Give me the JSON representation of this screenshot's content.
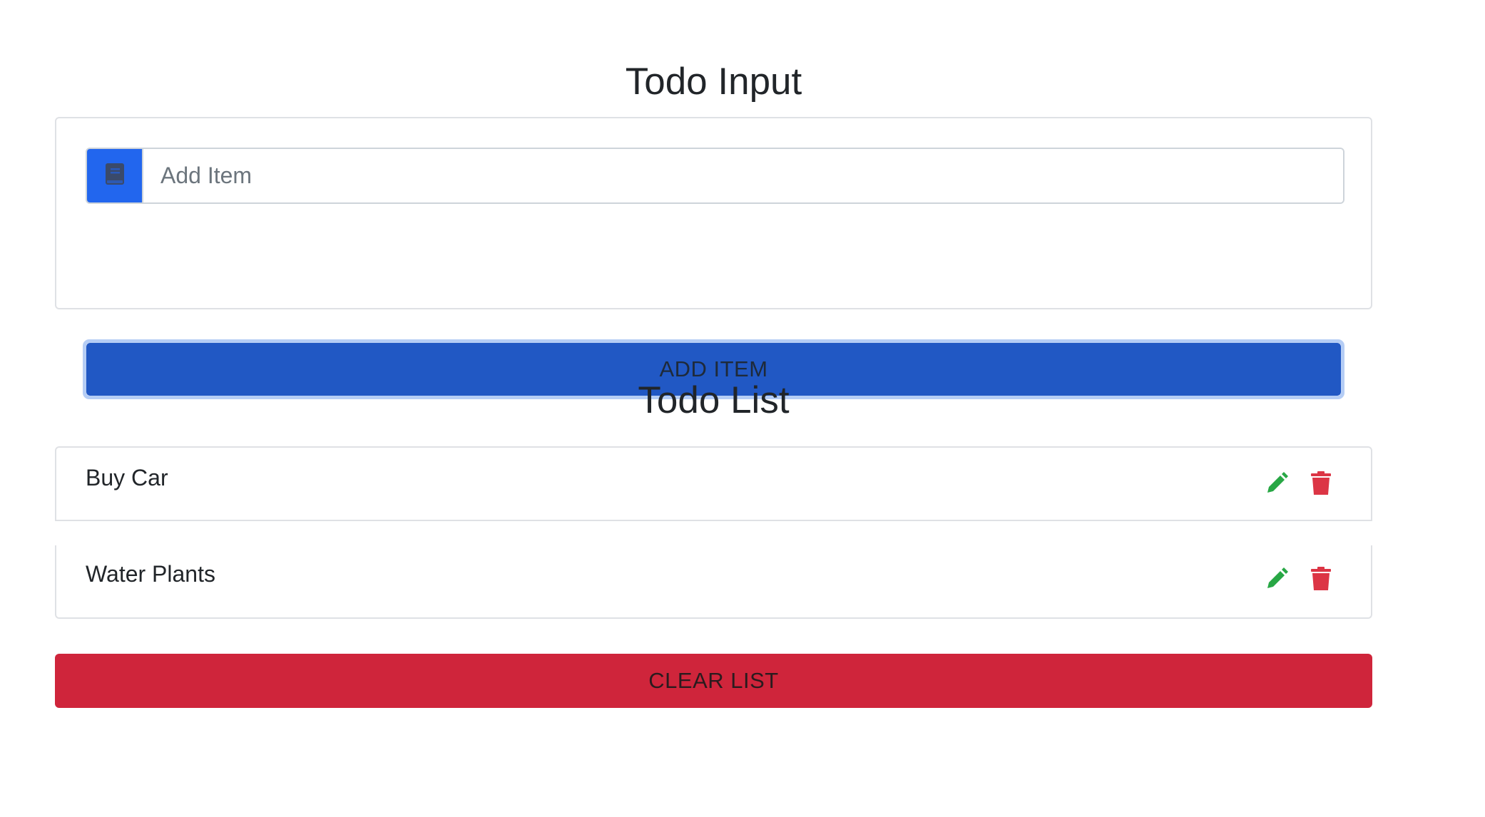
{
  "input_section": {
    "title": "Todo Input",
    "input_placeholder": "Add Item",
    "input_value": "",
    "prepend_icon": "book-icon",
    "add_button_label": "ADD ITEM"
  },
  "list_section": {
    "title": "Todo List",
    "items": [
      {
        "label": "Buy Car",
        "edit_icon": "pencil-icon",
        "delete_icon": "trash-icon"
      },
      {
        "label": "Water Plants",
        "edit_icon": "pencil-icon",
        "delete_icon": "trash-icon"
      }
    ],
    "clear_button_label": "CLEAR LIST"
  },
  "colors": {
    "primary": "#2158c4",
    "prepend": "#2266ee",
    "danger": "#cf253b",
    "edit_icon": "#28a745",
    "delete_icon": "#dc3545"
  }
}
